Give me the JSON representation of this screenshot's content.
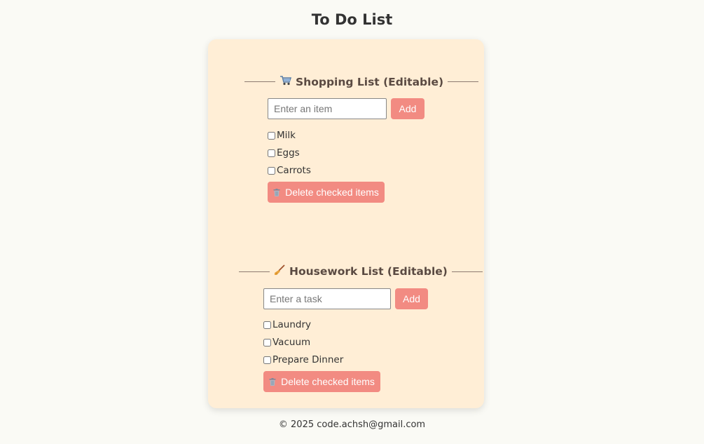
{
  "page": {
    "title": "To Do List"
  },
  "shopping": {
    "icon": "shopping-cart-icon",
    "heading": "Shopping List (Editable)",
    "input_placeholder": "Enter an item",
    "add_label": "Add",
    "items": [
      {
        "label": "Milk",
        "checked": false
      },
      {
        "label": "Eggs",
        "checked": false
      },
      {
        "label": "Carrots",
        "checked": false
      }
    ],
    "delete_label": "Delete checked items"
  },
  "housework": {
    "icon": "broom-icon",
    "heading": "Housework List (Editable)",
    "input_placeholder": "Enter a task",
    "add_label": "Add",
    "items": [
      {
        "label": "Laundry",
        "checked": false
      },
      {
        "label": "Vacuum",
        "checked": false
      },
      {
        "label": "Prepare Dinner",
        "checked": false
      }
    ],
    "delete_label": "Delete checked items"
  },
  "footer": {
    "text": "© 2025 code.achsh@gmail.com"
  },
  "colors": {
    "background": "#fafaf5",
    "card": "#ffeed6",
    "button": "#f28b82",
    "heading_text": "#5a4a42"
  }
}
